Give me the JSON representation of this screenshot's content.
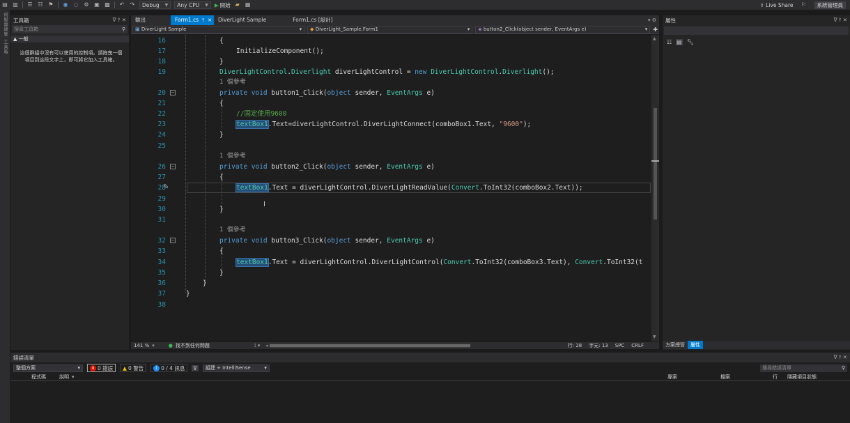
{
  "toolbar": {
    "config": "Debug",
    "platform": "Any CPU",
    "start_label": "開始",
    "live_share": "Live Share",
    "account": "系統管理員"
  },
  "left_strip": {
    "vertical_tabs": [
      "伺服器總管",
      "工具箱"
    ]
  },
  "toolbox": {
    "title": "工具箱",
    "search_placeholder": "搜尋工具箱",
    "group": "▲ 一般",
    "empty_message": "這個群組中沒有可以使用的控制項。請拖曳一個項目到這段文字上，即可將它加入工具箱。",
    "pin": "ᐁ ⫯ ✕"
  },
  "tabs": [
    {
      "label": "輸出",
      "active": false
    },
    {
      "label": "Form1.cs",
      "active": true,
      "pin": "⫯",
      "close": "✕"
    },
    {
      "label": "DiverLight Sample",
      "active": false
    },
    {
      "label": "Form1.cs [設計]",
      "active": false
    }
  ],
  "navbar": {
    "project": "DiverLight Sample",
    "class": "DiverLight_Sample.Form1",
    "member": "button2_Click(object sender, EventArgs e)"
  },
  "code": {
    "line_numbers": [
      "16",
      "17",
      "18",
      "19",
      "20",
      "21",
      "22",
      "23",
      "24",
      "25",
      "26",
      "27",
      "28",
      "29",
      "30",
      "31",
      "32",
      "33",
      "34",
      "35",
      "36",
      "37",
      "38"
    ],
    "ref_label": "1 個參考",
    "lines": {
      "l16": "{",
      "l17": "InitializeComponent();",
      "l18": "}",
      "l19_t1": "DiverLightControl",
      "l19_t2": ".",
      "l19_t3": "Diverlight",
      "l19_t4": " diverLightControl = ",
      "l19_t5": "new",
      "l19_t6": " ",
      "l19_t7": "DiverLightControl",
      "l19_t8": ".",
      "l19_t9": "Diverlight",
      "l19_t10": "();",
      "l20_kw": "private void",
      "l20_rest": " button1_Click(",
      "l20_kw2": "object",
      "l20_rest2": " sender, ",
      "l20_ty": "EventArgs",
      "l20_rest3": " e)",
      "l22_comment": "//固定使用9600",
      "l23_hl": "textBox1",
      "l23_rest": ".Text=diverLightControl.DiverLightConnect(comboBox1.Text, ",
      "l23_str": "\"9600\"",
      "l23_end": ");",
      "l26_rest": " button2_Click(",
      "l28_hl": "textBox1",
      "l28_rest": ".Text = diverLightControl.DiverLightReadValue(",
      "l28_ty": "Convert",
      "l28_rest2": ".ToInt32(comboBox2.Text));",
      "l32_rest": " button3_Click(",
      "l34_hl": "textBox1",
      "l34_rest": ".Text = diverLightControl.DiverLightControl(",
      "l34_ty": "Convert",
      "l34_rest2": ".ToInt32(comboBox3.Text), ",
      "l34_ty2": "Convert",
      "l34_rest3": ".ToInt32(t",
      "l36": "}",
      "l37": "}"
    }
  },
  "statusline": {
    "zoom": "141 %",
    "issues": "找不到任何問題",
    "line": "行: 28",
    "col": "字元: 13",
    "spc": "SPC",
    "crlf": "CRLF"
  },
  "properties": {
    "title": "屬性",
    "pin": "ᐁ ⫯ ✕"
  },
  "bottom_tabs": {
    "solution_explorer": "方案總管",
    "properties": "屬性"
  },
  "error_list": {
    "title": "錯誤清單",
    "scope": "整個方案",
    "errors": "0 錯誤",
    "warnings": "0 警告",
    "messages": "0 / 4 訊息",
    "build_filter": "組建 + IntelliSense",
    "search_placeholder": "搜尋錯誤清單",
    "columns": {
      "code": "程式碼",
      "desc": "說明",
      "project": "專案",
      "file": "檔案",
      "line": "行",
      "suppress": "隱藏項目狀態"
    }
  },
  "colors": {
    "accent": "#007acc",
    "keyword": "#569cd6",
    "type": "#4ec9b0",
    "comment": "#57a64a",
    "linenum": "#2b91af"
  }
}
